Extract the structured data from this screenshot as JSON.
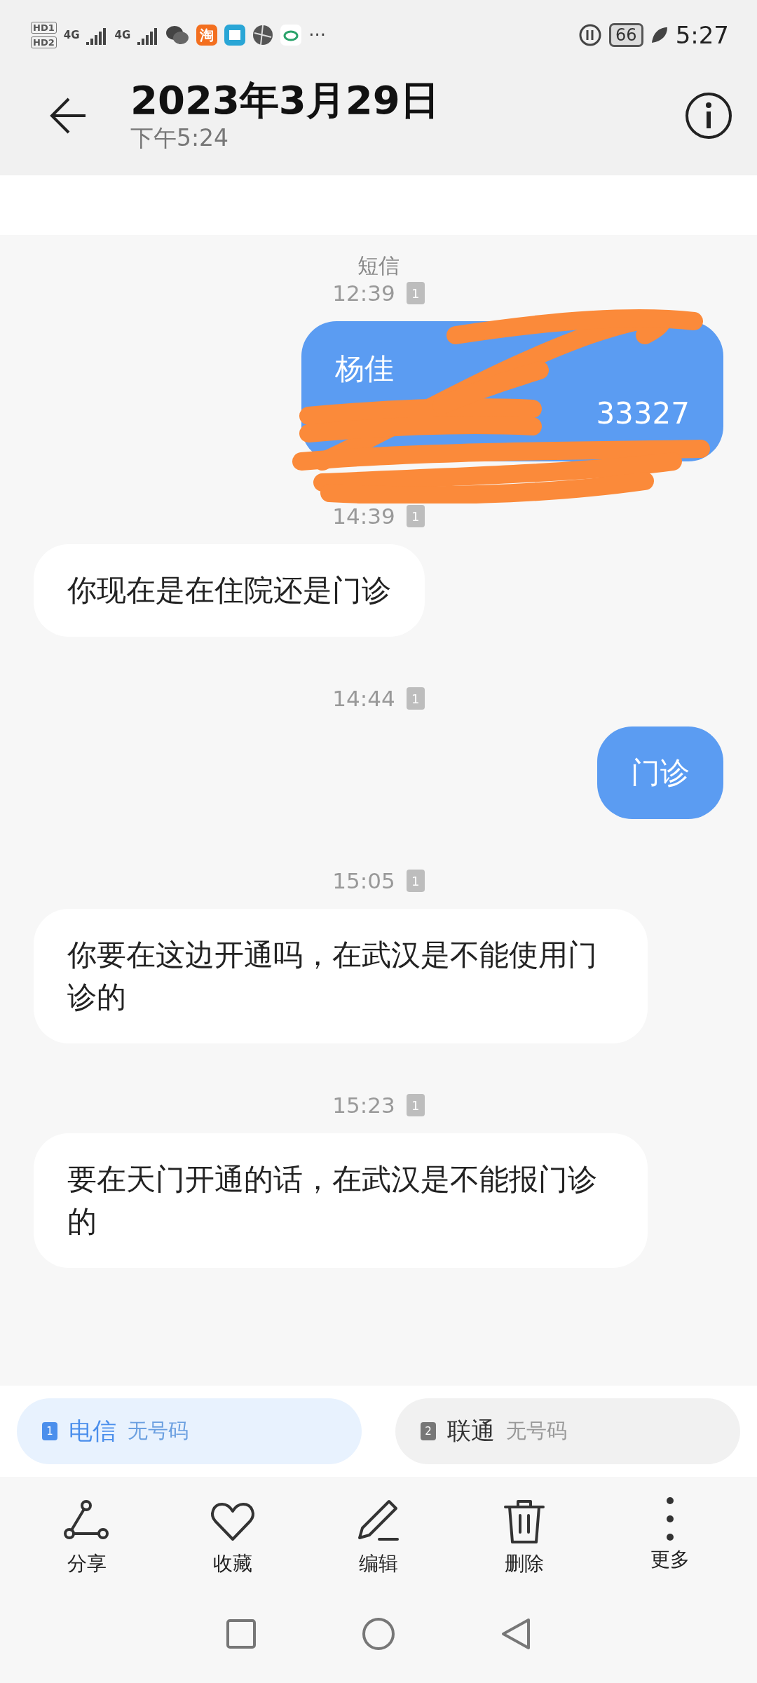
{
  "status_bar": {
    "hd": [
      {
        "text": "HD",
        "index": "1"
      },
      {
        "text": "HD",
        "index": "2"
      }
    ],
    "network": [
      "4G",
      "4G"
    ],
    "app_text": "淘",
    "more": "···",
    "battery": "66",
    "time": "5:27"
  },
  "header": {
    "title": "2023年3月29日",
    "subtitle": "下午5:24"
  },
  "messages": [
    {
      "kind": "label",
      "text": "短信"
    },
    {
      "kind": "time",
      "text": "12:39",
      "sim": "1"
    },
    {
      "kind": "redacted",
      "line_1": "杨佳",
      "line_2_end": "33327"
    },
    {
      "kind": "time",
      "text": "14:39",
      "sim": "1"
    },
    {
      "kind": "incoming",
      "text": "你现在是在住院还是门诊"
    },
    {
      "kind": "time",
      "text": "14:44",
      "sim": "1"
    },
    {
      "kind": "outgoing",
      "text": "门诊"
    },
    {
      "kind": "time",
      "text": "15:05",
      "sim": "1"
    },
    {
      "kind": "incoming",
      "text": "你要在这边开通吗，在武汉是不能使用门诊的"
    },
    {
      "kind": "time",
      "text": "15:23",
      "sim": "1"
    },
    {
      "kind": "incoming",
      "text": "要在天门开通的话，在武汉是不能报门诊的"
    }
  ],
  "sim_choices": [
    {
      "index": "1",
      "carrier": "电信",
      "number": "无号码",
      "selected": true
    },
    {
      "index": "2",
      "carrier": "联通",
      "number": "无号码",
      "selected": false
    }
  ],
  "toolbar": [
    {
      "kind": "share",
      "label": "分享"
    },
    {
      "kind": "favorite",
      "label": "收藏"
    },
    {
      "kind": "edit",
      "label": "编辑"
    },
    {
      "kind": "delete",
      "label": "删除"
    },
    {
      "kind": "more",
      "label": "更多"
    }
  ]
}
